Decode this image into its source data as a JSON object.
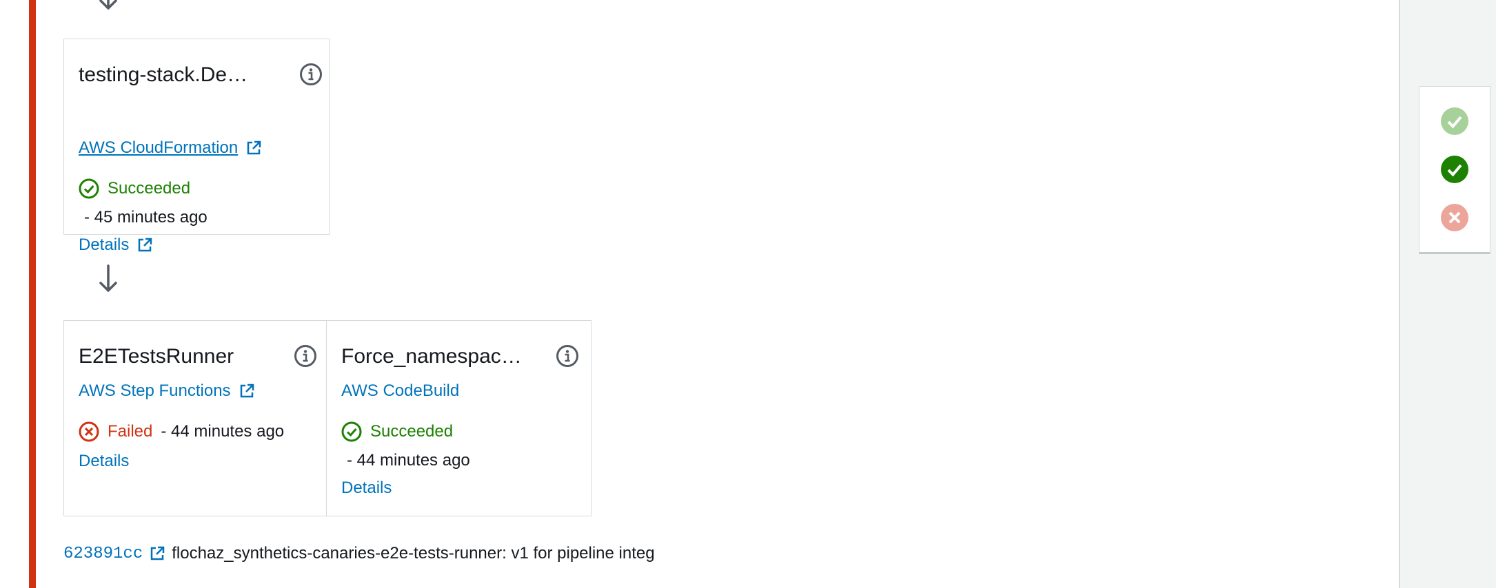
{
  "stage": {
    "status_color": "#d13212"
  },
  "actions": [
    {
      "name": "testing-stack.De…",
      "provider": "AWS CloudFormation",
      "provider_external": true,
      "status": "Succeeded",
      "status_type": "success",
      "time": "-  45 minutes ago",
      "details_label": "Details",
      "details_external": true
    },
    {
      "name": "E2ETestsRunner",
      "provider": "AWS Step Functions",
      "provider_external": true,
      "status": "Failed",
      "status_type": "failed",
      "time": "-  44 minutes ago",
      "details_label": "Details",
      "details_external": false
    },
    {
      "name": "Force_namespace…",
      "provider": "AWS CodeBuild",
      "provider_external": false,
      "status": "Succeeded",
      "status_type": "success",
      "time": "-  44 minutes ago",
      "details_label": "Details",
      "details_external": false
    }
  ],
  "commit": {
    "id": "623891cc",
    "message": "flochaz_synthetics-canaries-e2e-tests-runner: v1 for pipeline integ"
  },
  "legend": {
    "items": [
      "success-faded-icon",
      "success-icon",
      "failed-faded-icon"
    ]
  },
  "icons": {
    "info": "info-icon",
    "external": "external-link-icon",
    "arrow": "arrow-down-icon"
  },
  "colors": {
    "link": "#0073bb",
    "success": "#1d8102",
    "failed": "#d13212",
    "border": "#d5dbdb"
  }
}
